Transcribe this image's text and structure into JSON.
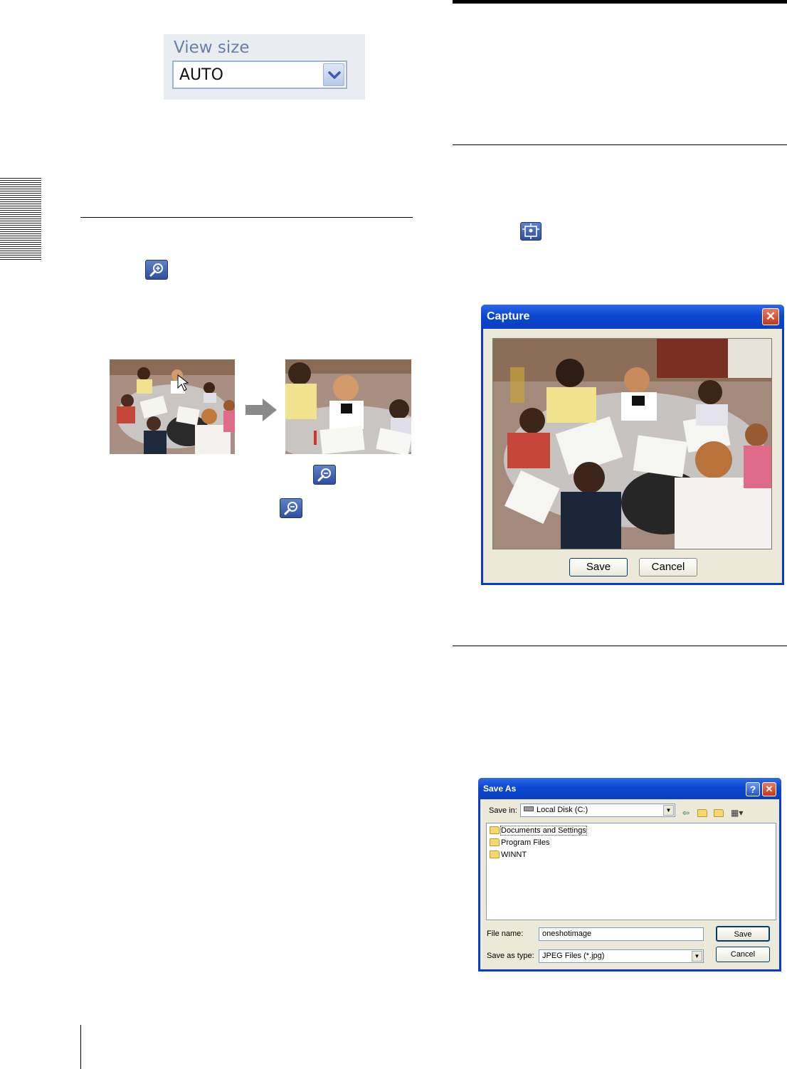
{
  "view_size": {
    "label": "View size",
    "value": "AUTO"
  },
  "capture_dialog": {
    "title": "Capture",
    "close_glyph": "✕",
    "save_label": "Save",
    "cancel_label": "Cancel"
  },
  "saveas_dialog": {
    "title": "Save As",
    "help_glyph": "?",
    "close_glyph": "✕",
    "save_in_label": "Save in:",
    "save_in_value": "Local Disk (C:)",
    "folders": [
      "Documents and Settings",
      "Program Files",
      "WINNT"
    ],
    "file_name_label": "File name:",
    "file_name_value": "oneshotimage",
    "save_as_type_label": "Save as type:",
    "save_as_type_value": "JPEG Files (*.jpg)",
    "save_label": "Save",
    "cancel_label": "Cancel"
  },
  "icons": {
    "zoom_in": "zoom-in-icon",
    "zoom_out": "zoom-out-icon",
    "capture": "capture-icon",
    "arrow": "right-arrow-icon"
  },
  "colors": {
    "xp_title": "#0b47d0",
    "dialog_bg": "#ece9d8",
    "icon_blue": "#3a5cae",
    "viewsize_label": "#6a7fa8"
  }
}
